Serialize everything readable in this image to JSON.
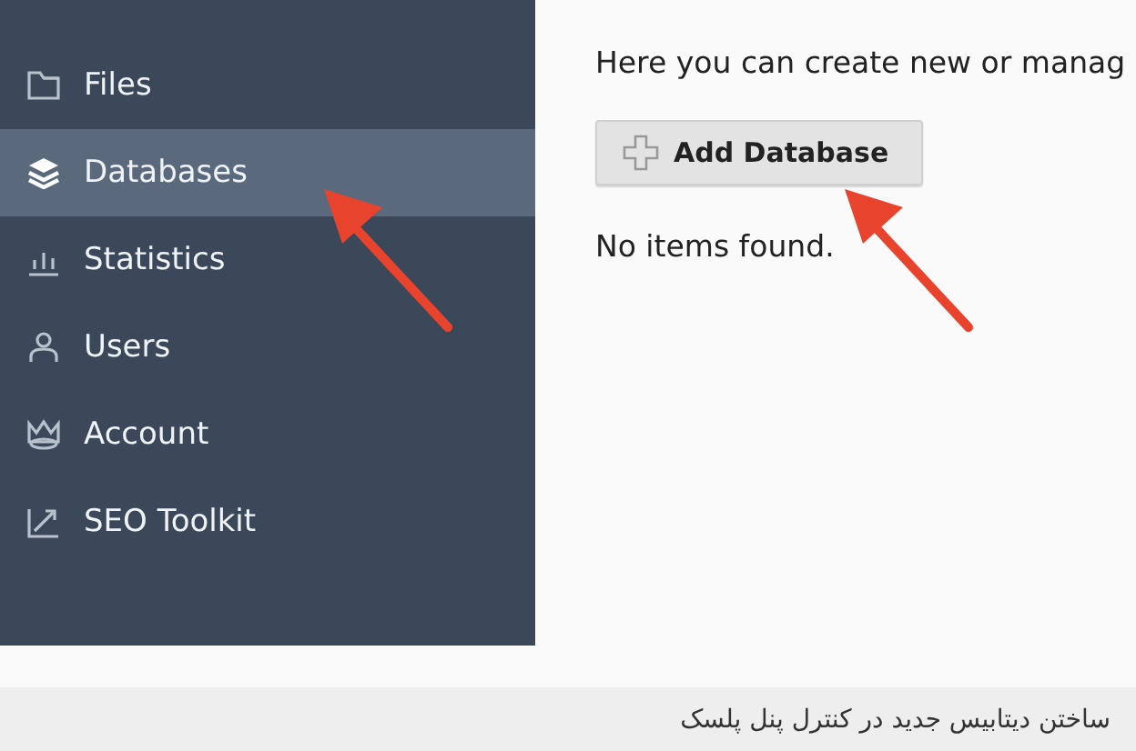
{
  "sidebar": {
    "items": [
      {
        "label": "Files",
        "selected": false
      },
      {
        "label": "Databases",
        "selected": true
      },
      {
        "label": "Statistics",
        "selected": false
      },
      {
        "label": "Users",
        "selected": false
      },
      {
        "label": "Account",
        "selected": false
      },
      {
        "label": "SEO Toolkit",
        "selected": false
      }
    ]
  },
  "main": {
    "intro": "Here you can create new or manag",
    "add_button": "Add Database",
    "empty_message": "No items found."
  },
  "caption": "ساختن دیتابیس جدید در کنترل پنل پلسک"
}
